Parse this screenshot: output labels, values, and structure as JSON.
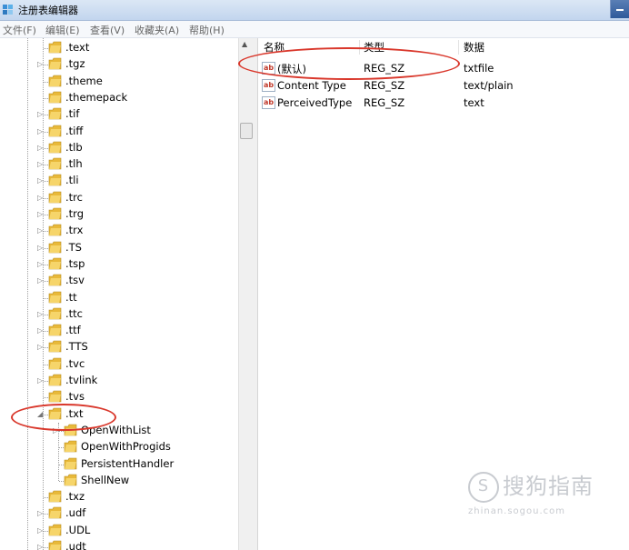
{
  "window": {
    "title": "注册表编辑器"
  },
  "menu": [
    "文件(F)",
    "编辑(E)",
    "查看(V)",
    "收藏夹(A)",
    "帮助(H)"
  ],
  "tree": {
    "items": [
      {
        "label": ".text",
        "expander": ""
      },
      {
        "label": ".tgz",
        "expander": "▷"
      },
      {
        "label": ".theme",
        "expander": ""
      },
      {
        "label": ".themepack",
        "expander": ""
      },
      {
        "label": ".tif",
        "expander": "▷"
      },
      {
        "label": ".tiff",
        "expander": "▷"
      },
      {
        "label": ".tlb",
        "expander": "▷"
      },
      {
        "label": ".tlh",
        "expander": "▷"
      },
      {
        "label": ".tli",
        "expander": "▷"
      },
      {
        "label": ".trc",
        "expander": "▷"
      },
      {
        "label": ".trg",
        "expander": "▷"
      },
      {
        "label": ".trx",
        "expander": "▷"
      },
      {
        "label": ".TS",
        "expander": "▷"
      },
      {
        "label": ".tsp",
        "expander": "▷"
      },
      {
        "label": ".tsv",
        "expander": "▷"
      },
      {
        "label": ".tt",
        "expander": ""
      },
      {
        "label": ".ttc",
        "expander": "▷"
      },
      {
        "label": ".ttf",
        "expander": "▷"
      },
      {
        "label": ".TTS",
        "expander": "▷"
      },
      {
        "label": ".tvc",
        "expander": ""
      },
      {
        "label": ".tvlink",
        "expander": "▷"
      },
      {
        "label": ".tvs",
        "expander": ""
      },
      {
        "label": ".txt",
        "expander": "◢",
        "expanded": true
      },
      {
        "label": "OpenWithList",
        "expander": "▷",
        "child": true
      },
      {
        "label": "OpenWithProgids",
        "expander": "",
        "child": true
      },
      {
        "label": "PersistentHandler",
        "expander": "",
        "child": true
      },
      {
        "label": "ShellNew",
        "expander": "",
        "child": true
      },
      {
        "label": ".txz",
        "expander": ""
      },
      {
        "label": ".udf",
        "expander": "▷"
      },
      {
        "label": ".UDL",
        "expander": "▷"
      },
      {
        "label": ".udt",
        "expander": "▷"
      }
    ]
  },
  "columns": {
    "name": "名称",
    "type": "类型",
    "data": "数据"
  },
  "values": [
    {
      "name": "(默认)",
      "type": "REG_SZ",
      "data": "txtfile"
    },
    {
      "name": "Content Type",
      "type": "REG_SZ",
      "data": "text/plain"
    },
    {
      "name": "PerceivedType",
      "type": "REG_SZ",
      "data": "text"
    }
  ],
  "value_icon": "ab",
  "watermark": {
    "main": "搜狗指南",
    "sub": "zhinan.sogou.com",
    "logo": "S"
  },
  "colors": {
    "annotation": "#d9372b",
    "folder": "#e8b93a"
  }
}
